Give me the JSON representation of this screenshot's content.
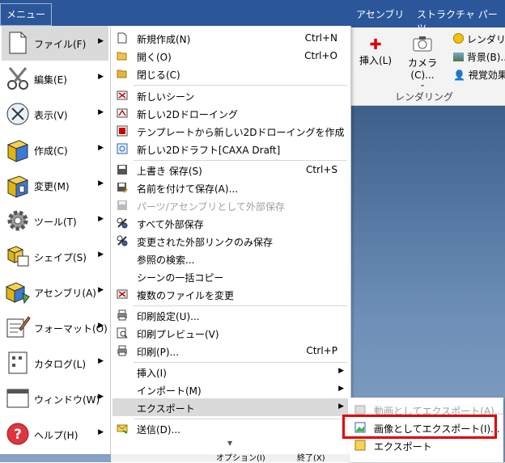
{
  "ribbon": {
    "tab_assembly": "アセンブリ",
    "tab_structure": "ストラクチャ パーツ",
    "insert_label": "挿入(L)",
    "camera_label": "カメラ(C)...",
    "rendering_label": "レンダリン",
    "background_label": "背景(B)...",
    "visual_effect_label": "視覚効果",
    "group_label": "レンダリング"
  },
  "menu_tab": "メニュー",
  "left_menu": [
    {
      "label": "ファイル(F)",
      "icon": "file-icon"
    },
    {
      "label": "編集(E)",
      "icon": "scissors-icon"
    },
    {
      "label": "表示(V)",
      "icon": "view-icon"
    },
    {
      "label": "作成(C)",
      "icon": "create-icon"
    },
    {
      "label": "変更(M)",
      "icon": "modify-icon"
    },
    {
      "label": "ツール(T)",
      "icon": "gear-icon"
    },
    {
      "label": "シェイプ(S)",
      "icon": "shape-icon"
    },
    {
      "label": "アセンブリ(A)",
      "icon": "assembly-icon"
    },
    {
      "label": "フォーマット(O)",
      "icon": "format-icon"
    },
    {
      "label": "カタログ(L)",
      "icon": "catalog-icon"
    },
    {
      "label": "ウィンドウ(W)",
      "icon": "window-icon"
    },
    {
      "label": "ヘルプ(H)",
      "icon": "help-icon"
    }
  ],
  "file_menu": {
    "new": "新規作成(N)",
    "new_short": "Ctrl+N",
    "open": "開く(O)",
    "open_short": "Ctrl+O",
    "close": "閉じる(C)",
    "new_scene": "新しいシーン",
    "new_2d_drawing": "新しい2Dドローイング",
    "new_2d_from_template": "テンプレートから新しい2Dドローイングを作成",
    "new_2d_draft": "新しい2Dドラフト[CAXA Draft]",
    "save": "上書き 保存(S)",
    "save_short": "Ctrl+S",
    "save_as": "名前を付けて保存(A)...",
    "save_parts": "パーツ/アセンブリとして外部保存",
    "save_all_external": "すべて外部保存",
    "save_changed_links": "変更された外部リンクのみ保存",
    "find_refs": "参照の検索...",
    "batch_copy": "シーンの一括コピー",
    "change_multiple": "複数のファイルを変更",
    "print_setup": "印刷設定(U)...",
    "print_preview": "印刷プレビュー(V)",
    "print": "印刷(P)...",
    "print_short": "Ctrl+P",
    "insert": "挿入(I)",
    "import": "インポート(M)",
    "export": "エクスポート",
    "send": "送信(D)..."
  },
  "export_menu": {
    "as_video": "動画としてエクスポート(A)...",
    "as_image": "画像としてエクスポート(I)...",
    "export": "エクスポート"
  },
  "footer": {
    "options": "オプション(I)",
    "exit": "終了(X)"
  }
}
